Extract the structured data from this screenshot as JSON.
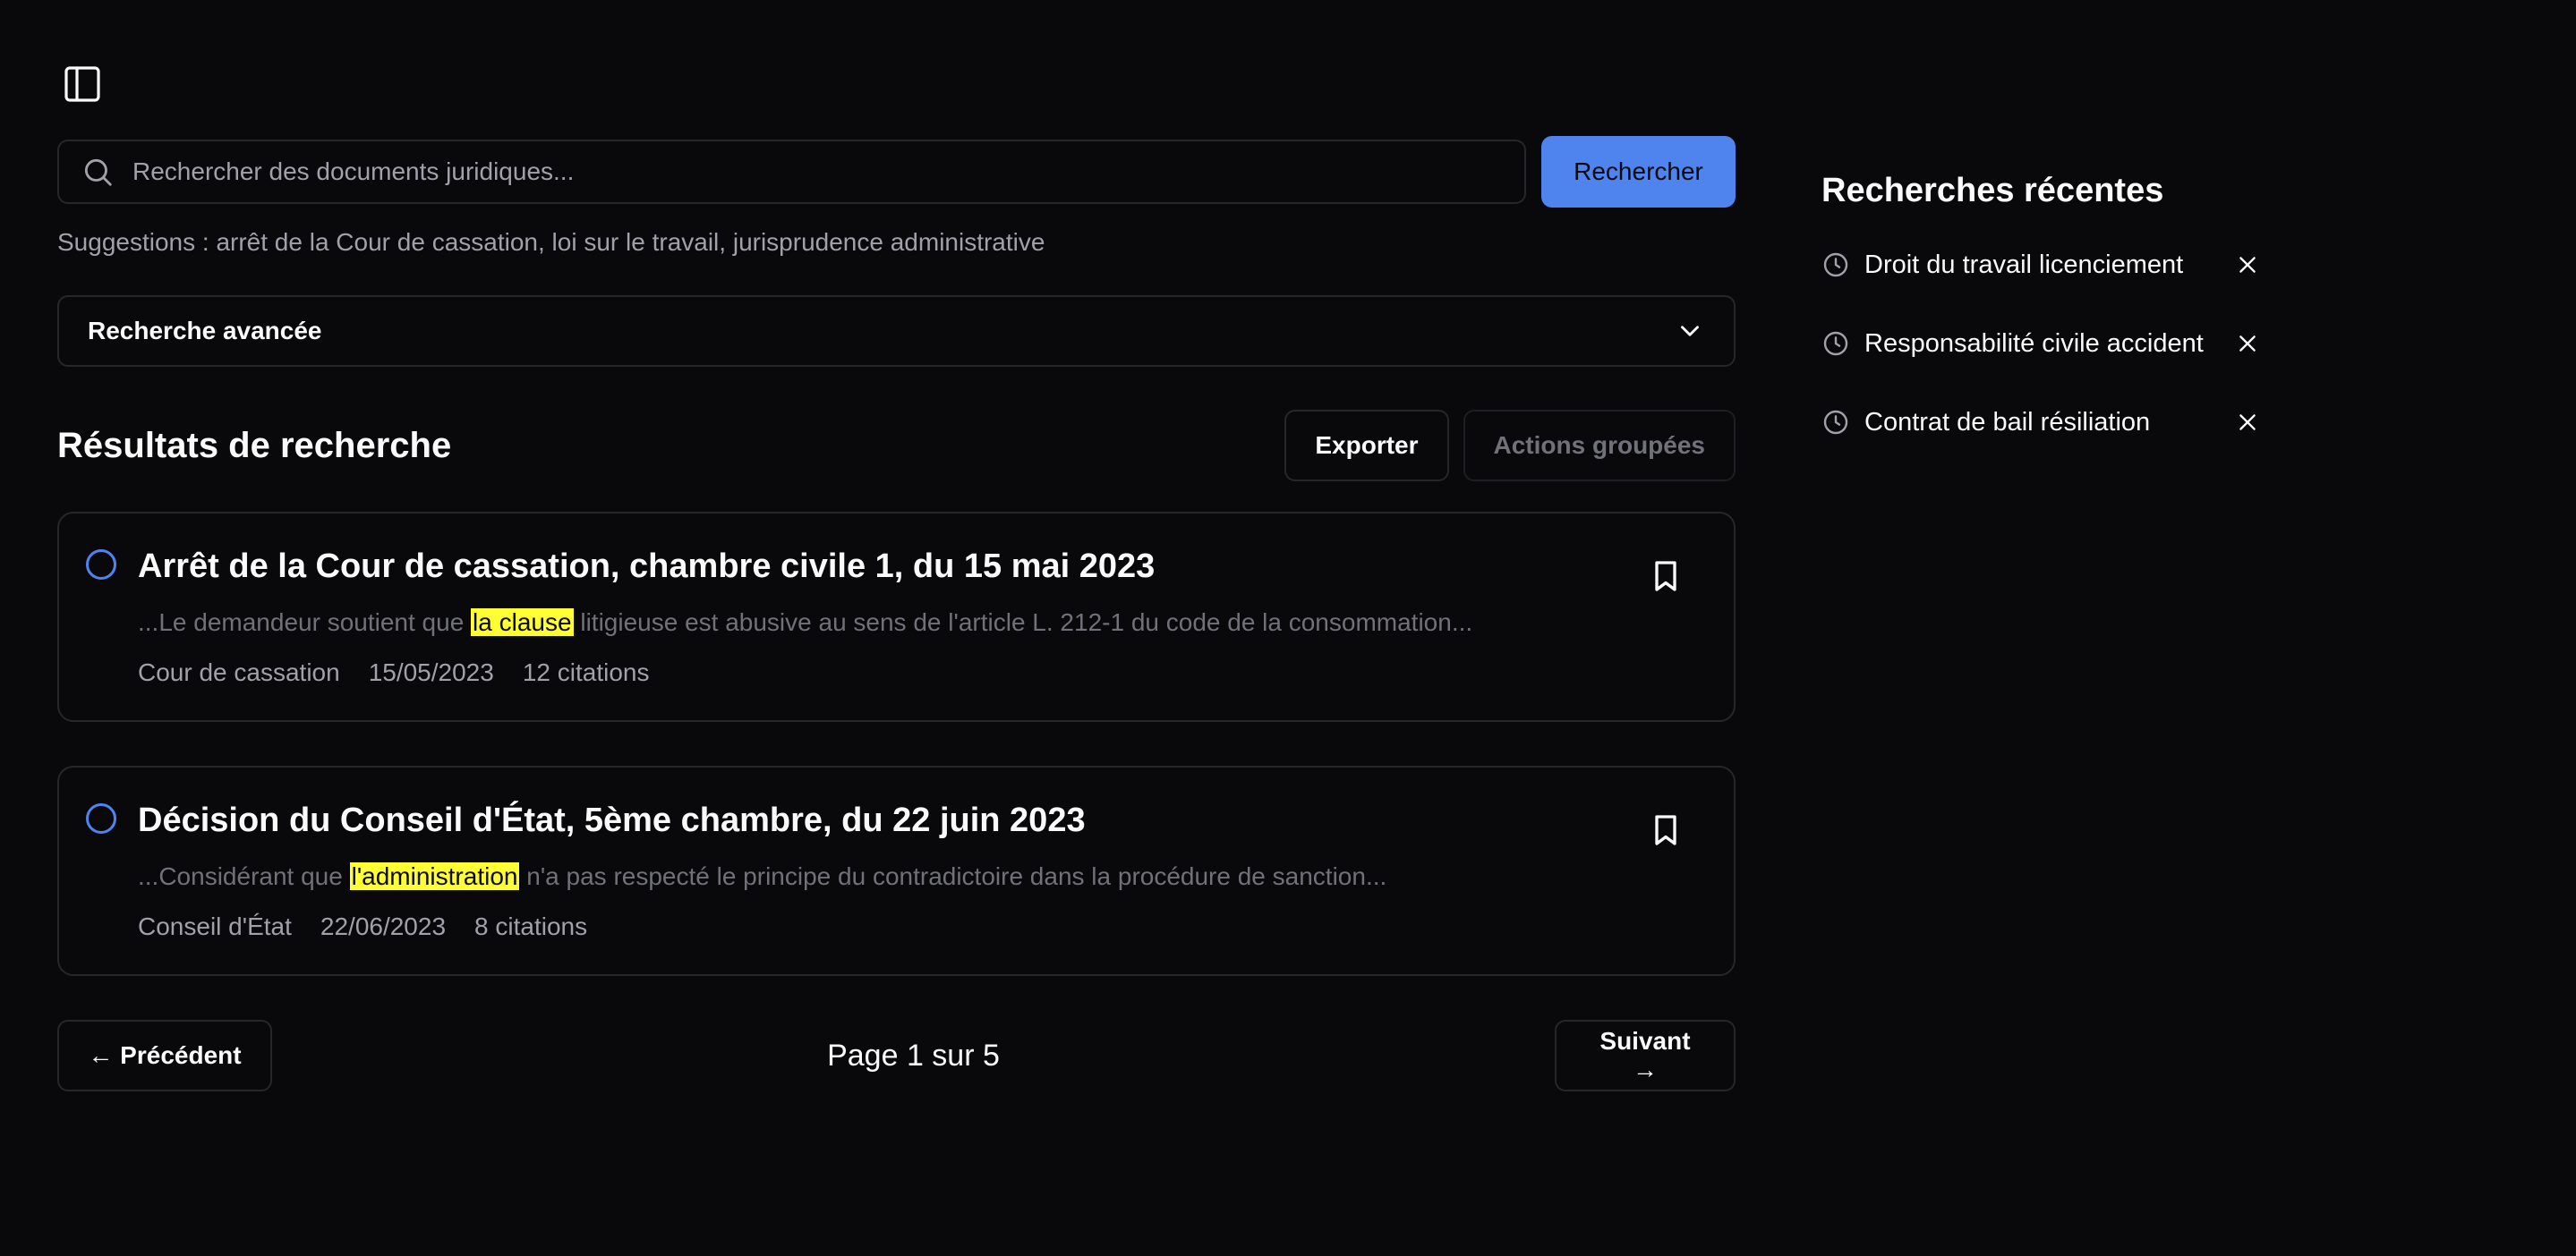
{
  "search": {
    "placeholder": "Rechercher des documents juridiques...",
    "button_label": "Rechercher",
    "suggestions_prefix": "Suggestions : ",
    "suggestions": [
      "arrêt de la Cour de cassation",
      "loi sur le travail",
      "jurisprudence administrative"
    ]
  },
  "advanced": {
    "label": "Recherche avancée"
  },
  "results": {
    "title": "Résultats de recherche",
    "export_label": "Exporter",
    "bulk_label": "Actions groupées",
    "items": [
      {
        "title": "Arrêt de la Cour de cassation, chambre civile 1, du 15 mai 2023",
        "snippet_before": "...Le demandeur soutient que ",
        "snippet_highlight": "la clause",
        "snippet_after": " litigieuse est abusive au sens de l'article L. 212-1 du code de la consommation...",
        "court": "Cour de cassation",
        "date": "15/05/2023",
        "citations": "12 citations"
      },
      {
        "title": "Décision du Conseil d'État, 5ème chambre, du 22 juin 2023",
        "snippet_before": "...Considérant que ",
        "snippet_highlight": "l'administration",
        "snippet_after": " n'a pas respecté le principe du contradictoire dans la procédure de sanction...",
        "court": "Conseil d'État",
        "date": "22/06/2023",
        "citations": "8 citations"
      }
    ]
  },
  "pagination": {
    "prev_label": "← Précédent",
    "indicator": "Page 1 sur 5",
    "next_label": "Suivant →"
  },
  "recent": {
    "title": "Recherches récentes",
    "items": [
      "Droit du travail licenciement",
      "Responsabilité civile accident",
      "Contrat de bail résiliation"
    ]
  },
  "colors": {
    "background": "#09090b",
    "accent": "#4f83ee",
    "highlight": "#ffff33",
    "border": "#27272a",
    "muted": "#a1a1aa"
  },
  "icons": {
    "sidebar_toggle": "panel-left-icon",
    "search": "search-icon",
    "chevron": "chevron-down-icon",
    "bookmark": "bookmark-icon",
    "clock": "clock-icon",
    "remove": "close-icon"
  }
}
